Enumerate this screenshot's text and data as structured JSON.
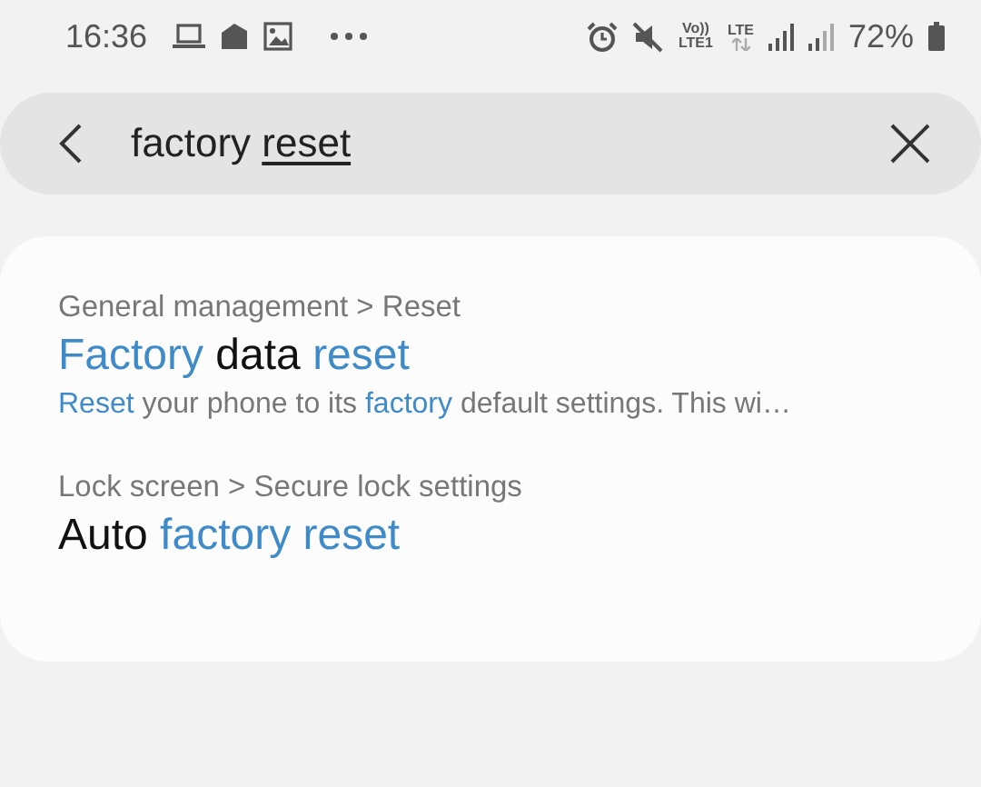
{
  "status_bar": {
    "time": "16:36",
    "volte": "Vo))",
    "volte_sub": "LTE1",
    "network": "LTE",
    "battery": "72%"
  },
  "search": {
    "segments": [
      {
        "text": "factory ",
        "underlined": false
      },
      {
        "text": "reset",
        "underlined": true
      }
    ]
  },
  "results": [
    {
      "path": "General management > Reset",
      "title": [
        {
          "text": "Factory",
          "highlight": true
        },
        {
          "text": " data ",
          "highlight": false
        },
        {
          "text": "reset",
          "highlight": true
        }
      ],
      "summary": [
        {
          "text": "Reset",
          "highlight": true
        },
        {
          "text": " your phone to its ",
          "highlight": false
        },
        {
          "text": "factory",
          "highlight": true
        },
        {
          "text": " default settings. This wi…",
          "highlight": false
        }
      ]
    },
    {
      "path": "Lock screen > Secure lock settings",
      "title": [
        {
          "text": "Auto ",
          "highlight": false
        },
        {
          "text": "factory reset",
          "highlight": true
        }
      ]
    }
  ]
}
